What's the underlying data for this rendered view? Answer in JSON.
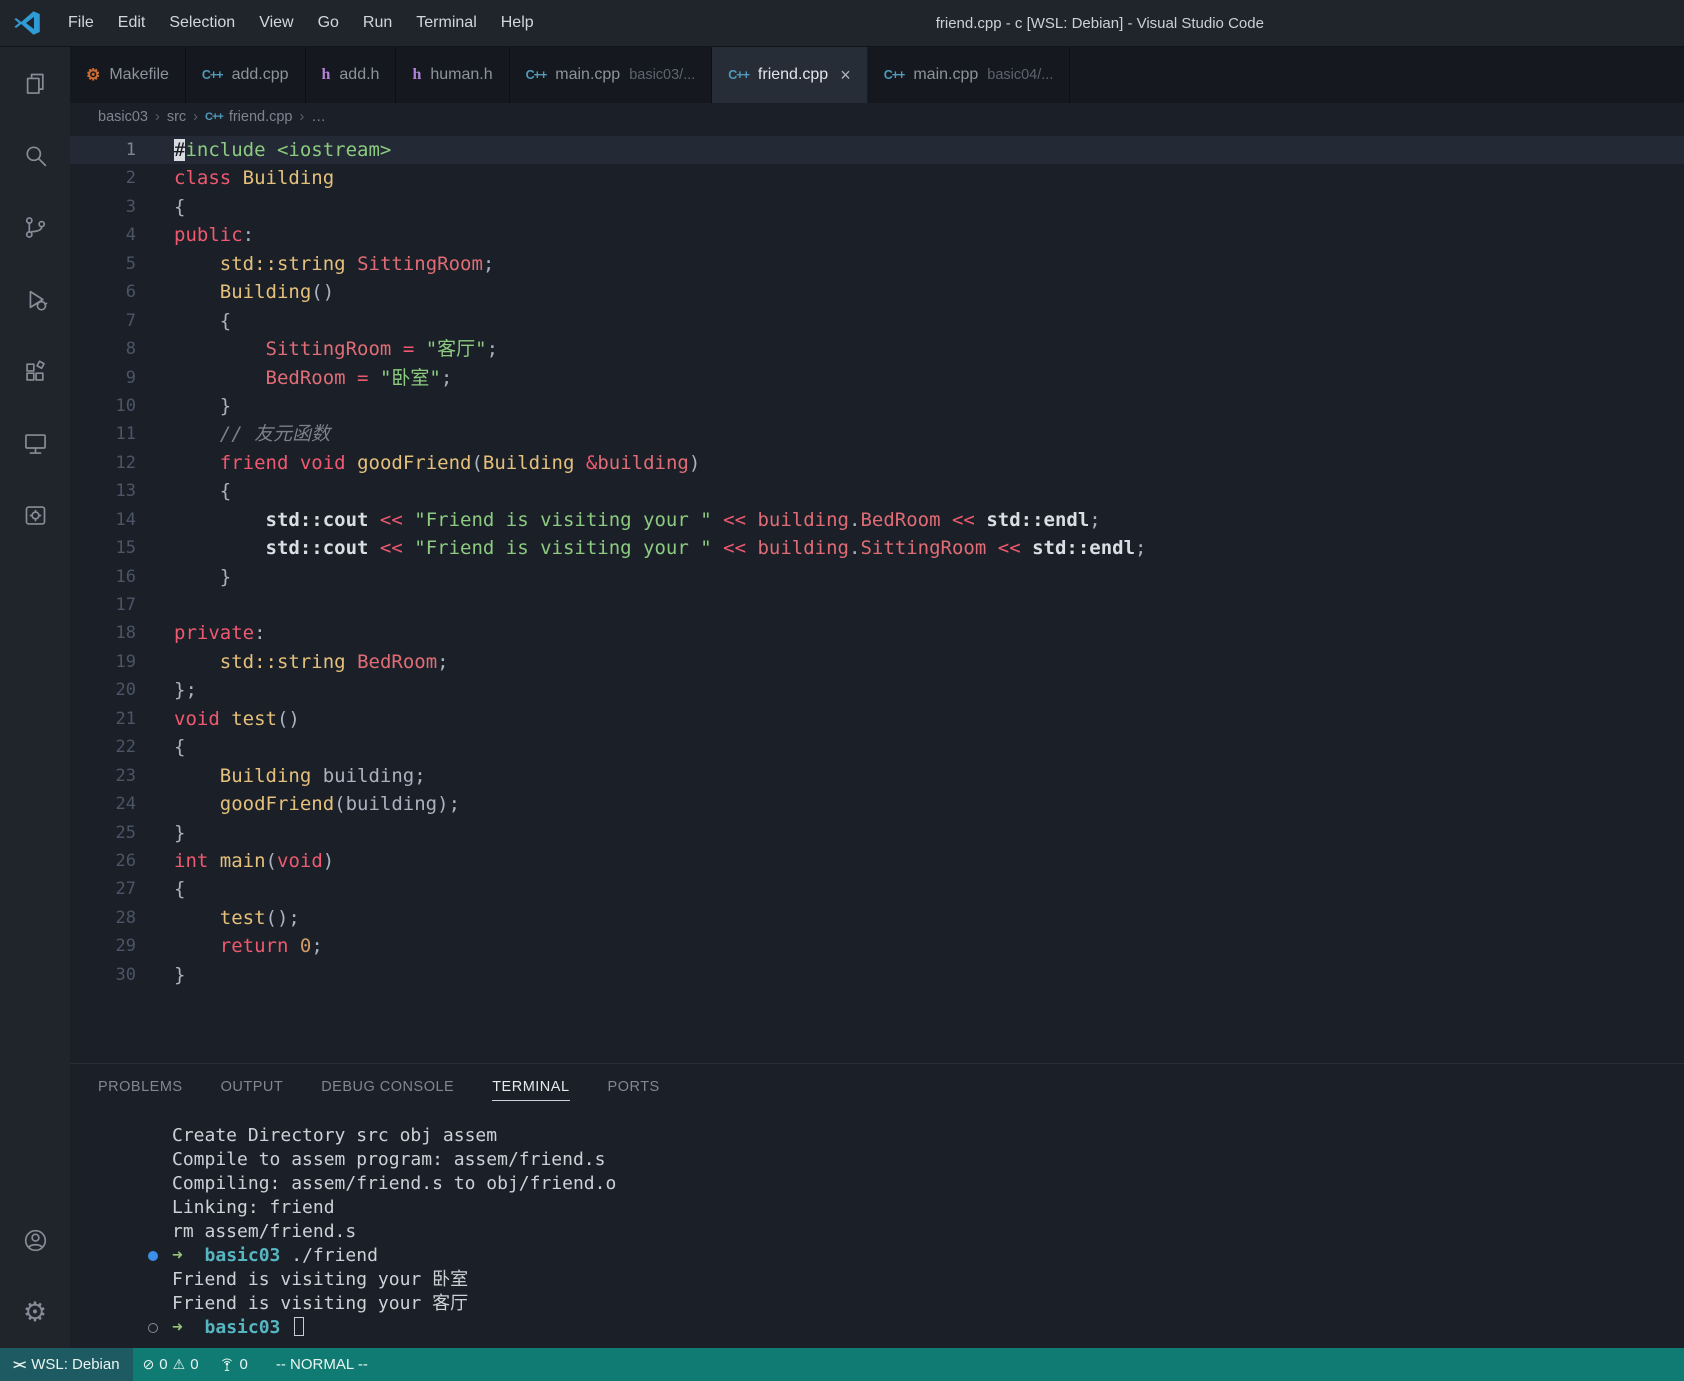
{
  "colors": {
    "statusbar_bg": "#0f7b73",
    "remote_bg": "#1e5a62",
    "accent_blue": "#3b8eea",
    "string_green": "#8ccb80",
    "keyword_red": "#ef596f"
  },
  "titlebar": {
    "menus": [
      "File",
      "Edit",
      "Selection",
      "View",
      "Go",
      "Run",
      "Terminal",
      "Help"
    ],
    "title": "friend.cpp - c [WSL: Debian] - Visual Studio Code"
  },
  "activity_bar": {
    "top": [
      "explorer",
      "search",
      "source-control",
      "run-debug",
      "extensions",
      "remote-explorer",
      "makefile-tools"
    ],
    "bottom": [
      "account",
      "settings"
    ]
  },
  "file_icons": {
    "cpp": "C++",
    "h": "h",
    "makefile": "⚙"
  },
  "glyphs": {
    "close": "×",
    "chevron": "›",
    "gear": "⚙",
    "error": "⊘",
    "warning": "⚠",
    "remote": "><"
  },
  "tabs": [
    {
      "label": "Makefile",
      "icon": "makefile",
      "active": false
    },
    {
      "label": "add.cpp",
      "icon": "cpp",
      "active": false
    },
    {
      "label": "add.h",
      "icon": "h",
      "active": false
    },
    {
      "label": "human.h",
      "icon": "h",
      "active": false
    },
    {
      "label": "main.cpp",
      "icon": "cpp",
      "desc": "basic03/...",
      "active": false
    },
    {
      "label": "friend.cpp",
      "icon": "cpp",
      "active": true,
      "close": true
    },
    {
      "label": "main.cpp",
      "icon": "cpp",
      "desc": "basic04/...",
      "active": false
    }
  ],
  "breadcrumb": {
    "items": [
      {
        "label": "basic03"
      },
      {
        "label": "src"
      },
      {
        "label": "friend.cpp",
        "icon": "cpp"
      },
      {
        "label": "…"
      }
    ]
  },
  "editor": {
    "current_line": 1,
    "lines": [
      {
        "n": 1,
        "toks": [
          [
            "cur",
            "#"
          ],
          [
            "pre",
            "include"
          ],
          [
            "pln",
            " "
          ],
          [
            "str",
            "<iostream>"
          ]
        ]
      },
      {
        "n": 2,
        "toks": [
          [
            "kw",
            "class"
          ],
          [
            "pln",
            " "
          ],
          [
            "typ",
            "Building"
          ]
        ]
      },
      {
        "n": 3,
        "toks": [
          [
            "pln",
            "{"
          ]
        ]
      },
      {
        "n": 4,
        "toks": [
          [
            "kw",
            "public"
          ],
          [
            "pln",
            ":"
          ]
        ]
      },
      {
        "n": 5,
        "toks": [
          [
            "pln",
            "    "
          ],
          [
            "typ",
            "std::string"
          ],
          [
            "pln",
            " "
          ],
          [
            "mem",
            "SittingRoom"
          ],
          [
            "pln",
            ";"
          ]
        ]
      },
      {
        "n": 6,
        "toks": [
          [
            "pln",
            "    "
          ],
          [
            "fn",
            "Building"
          ],
          [
            "pln",
            "()"
          ]
        ]
      },
      {
        "n": 7,
        "toks": [
          [
            "pln",
            "    {"
          ]
        ]
      },
      {
        "n": 8,
        "toks": [
          [
            "pln",
            "        "
          ],
          [
            "mem",
            "SittingRoom"
          ],
          [
            "pln",
            " "
          ],
          [
            "op",
            "="
          ],
          [
            "pln",
            " "
          ],
          [
            "str",
            "\"客厅\""
          ],
          [
            "pln",
            ";"
          ]
        ]
      },
      {
        "n": 9,
        "toks": [
          [
            "pln",
            "        "
          ],
          [
            "mem",
            "BedRoom"
          ],
          [
            "pln",
            " "
          ],
          [
            "op",
            "="
          ],
          [
            "pln",
            " "
          ],
          [
            "str",
            "\"卧室\""
          ],
          [
            "pln",
            ";"
          ]
        ]
      },
      {
        "n": 10,
        "toks": [
          [
            "pln",
            "    }"
          ]
        ]
      },
      {
        "n": 11,
        "toks": [
          [
            "pln",
            "    "
          ],
          [
            "com",
            "// 友元函数"
          ]
        ]
      },
      {
        "n": 12,
        "toks": [
          [
            "pln",
            "    "
          ],
          [
            "kw",
            "friend"
          ],
          [
            "pln",
            " "
          ],
          [
            "kw",
            "void"
          ],
          [
            "pln",
            " "
          ],
          [
            "fn",
            "goodFriend"
          ],
          [
            "pln",
            "("
          ],
          [
            "typ",
            "Building"
          ],
          [
            "pln",
            " "
          ],
          [
            "op",
            "&"
          ],
          [
            "mem",
            "building"
          ],
          [
            "pln",
            ")"
          ]
        ]
      },
      {
        "n": 13,
        "toks": [
          [
            "pln",
            "    {"
          ]
        ]
      },
      {
        "n": 14,
        "toks": [
          [
            "pln",
            "        "
          ],
          [
            "std",
            "std::cout"
          ],
          [
            "pln",
            " "
          ],
          [
            "op",
            "<<"
          ],
          [
            "pln",
            " "
          ],
          [
            "str",
            "\"Friend is visiting your \""
          ],
          [
            "pln",
            " "
          ],
          [
            "op",
            "<<"
          ],
          [
            "pln",
            " "
          ],
          [
            "mem",
            "building"
          ],
          [
            "pln",
            "."
          ],
          [
            "mem",
            "BedRoom"
          ],
          [
            "pln",
            " "
          ],
          [
            "op",
            "<<"
          ],
          [
            "pln",
            " "
          ],
          [
            "std",
            "std::endl"
          ],
          [
            "pln",
            ";"
          ]
        ]
      },
      {
        "n": 15,
        "toks": [
          [
            "pln",
            "        "
          ],
          [
            "std",
            "std::cout"
          ],
          [
            "pln",
            " "
          ],
          [
            "op",
            "<<"
          ],
          [
            "pln",
            " "
          ],
          [
            "str",
            "\"Friend is visiting your \""
          ],
          [
            "pln",
            " "
          ],
          [
            "op",
            "<<"
          ],
          [
            "pln",
            " "
          ],
          [
            "mem",
            "building"
          ],
          [
            "pln",
            "."
          ],
          [
            "mem",
            "SittingRoom"
          ],
          [
            "pln",
            " "
          ],
          [
            "op",
            "<<"
          ],
          [
            "pln",
            " "
          ],
          [
            "std",
            "std::endl"
          ],
          [
            "pln",
            ";"
          ]
        ]
      },
      {
        "n": 16,
        "toks": [
          [
            "pln",
            "    }"
          ]
        ]
      },
      {
        "n": 17,
        "toks": []
      },
      {
        "n": 18,
        "toks": [
          [
            "kw",
            "private"
          ],
          [
            "pln",
            ":"
          ]
        ]
      },
      {
        "n": 19,
        "toks": [
          [
            "pln",
            "    "
          ],
          [
            "typ",
            "std::string"
          ],
          [
            "pln",
            " "
          ],
          [
            "mem",
            "BedRoom"
          ],
          [
            "pln",
            ";"
          ]
        ]
      },
      {
        "n": 20,
        "toks": [
          [
            "pln",
            "};"
          ]
        ]
      },
      {
        "n": 21,
        "toks": [
          [
            "kw",
            "void"
          ],
          [
            "pln",
            " "
          ],
          [
            "fn",
            "test"
          ],
          [
            "pln",
            "()"
          ]
        ]
      },
      {
        "n": 22,
        "toks": [
          [
            "pln",
            "{"
          ]
        ]
      },
      {
        "n": 23,
        "toks": [
          [
            "pln",
            "    "
          ],
          [
            "typ",
            "Building"
          ],
          [
            "pln",
            " "
          ],
          [
            "pln",
            "building"
          ],
          [
            "pln",
            ";"
          ]
        ]
      },
      {
        "n": 24,
        "toks": [
          [
            "pln",
            "    "
          ],
          [
            "fn",
            "goodFriend"
          ],
          [
            "pln",
            "("
          ],
          [
            "pln",
            "building"
          ],
          [
            "pln",
            ");"
          ]
        ]
      },
      {
        "n": 25,
        "toks": [
          [
            "pln",
            "}"
          ]
        ]
      },
      {
        "n": 26,
        "toks": [
          [
            "kw",
            "int"
          ],
          [
            "pln",
            " "
          ],
          [
            "fn",
            "main"
          ],
          [
            "pln",
            "("
          ],
          [
            "kw",
            "void"
          ],
          [
            "pln",
            ")"
          ]
        ]
      },
      {
        "n": 27,
        "toks": [
          [
            "pln",
            "{"
          ]
        ]
      },
      {
        "n": 28,
        "toks": [
          [
            "pln",
            "    "
          ],
          [
            "fn",
            "test"
          ],
          [
            "pln",
            "();"
          ]
        ]
      },
      {
        "n": 29,
        "toks": [
          [
            "pln",
            "    "
          ],
          [
            "kw",
            "return"
          ],
          [
            "pln",
            " "
          ],
          [
            "num",
            "0"
          ],
          [
            "pln",
            ";"
          ]
        ]
      },
      {
        "n": 30,
        "toks": [
          [
            "pln",
            "}"
          ]
        ]
      }
    ]
  },
  "panel": {
    "tabs": [
      "PROBLEMS",
      "OUTPUT",
      "DEBUG CONSOLE",
      "TERMINAL",
      "PORTS"
    ],
    "active_tab": "TERMINAL"
  },
  "terminal": {
    "lines": [
      {
        "toks": [
          [
            "t",
            "Create Directory src obj assem"
          ]
        ]
      },
      {
        "toks": [
          [
            "t",
            "Compile to assem program: assem/friend.s"
          ]
        ]
      },
      {
        "toks": [
          [
            "t",
            "Compiling: assem/friend.s to obj/friend.o"
          ]
        ]
      },
      {
        "toks": [
          [
            "t",
            "Linking: friend"
          ]
        ]
      },
      {
        "toks": [
          [
            "t",
            "rm assem/friend.s"
          ]
        ]
      },
      {
        "dec": "done",
        "toks": [
          [
            "arrow",
            "➜"
          ],
          [
            "t",
            "  "
          ],
          [
            "dir",
            "basic03"
          ],
          [
            "t",
            " ./friend"
          ]
        ]
      },
      {
        "toks": [
          [
            "t",
            "Friend is visiting your 卧室"
          ]
        ]
      },
      {
        "toks": [
          [
            "t",
            "Friend is visiting your 客厅"
          ]
        ]
      },
      {
        "dec": "pending",
        "cursor": true,
        "toks": [
          [
            "arrow",
            "➜"
          ],
          [
            "t",
            "  "
          ],
          [
            "dir",
            "basic03"
          ],
          [
            "t",
            " "
          ]
        ]
      }
    ]
  },
  "statusbar": {
    "remote": "WSL: Debian",
    "errors": "0",
    "warnings": "0",
    "ports": "0",
    "mode": "-- NORMAL --"
  }
}
